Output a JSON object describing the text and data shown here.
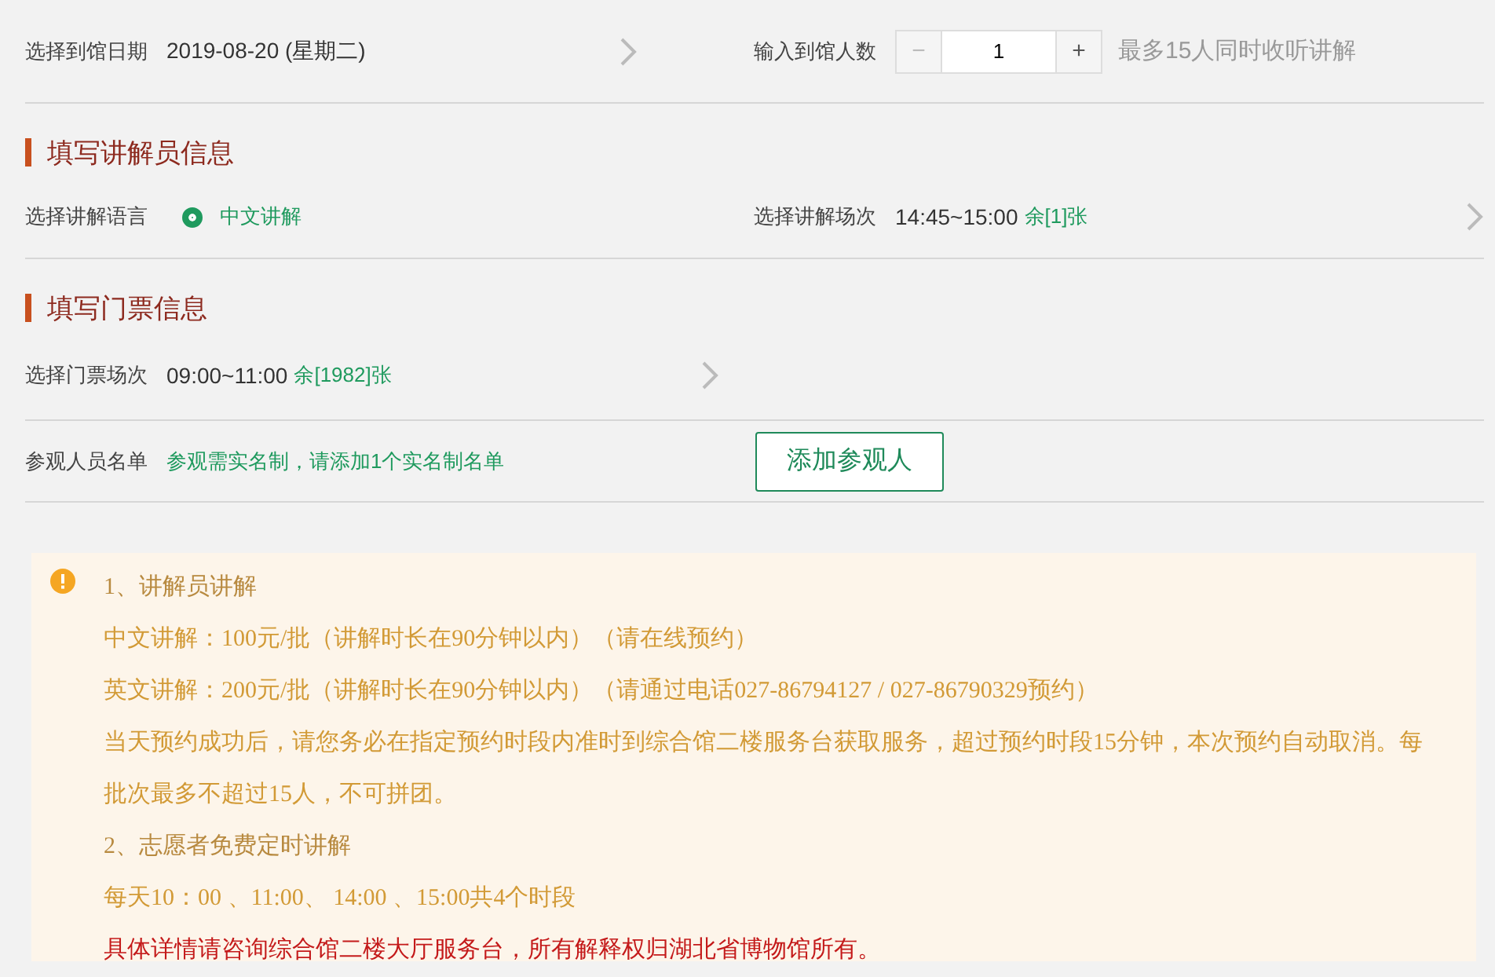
{
  "date_row": {
    "label": "选择到馆日期",
    "value": "2019-08-20 (星期二)"
  },
  "visitors": {
    "label": "输入到馆人数",
    "minus": "−",
    "minus_disabled": true,
    "value": "1",
    "plus": "+",
    "hint": "最多15人同时收听讲解"
  },
  "guide_section": {
    "title": "填写讲解员信息",
    "language": {
      "label": "选择讲解语言",
      "options": [
        {
          "label": "中文讲解",
          "selected": true
        }
      ]
    },
    "session": {
      "label": "选择讲解场次",
      "time": "14:45~15:00",
      "remaining": "余[1]张"
    }
  },
  "ticket_section": {
    "title": "填写门票信息",
    "session": {
      "label": "选择门票场次",
      "time": "09:00~11:00",
      "remaining": "余[1982]张"
    },
    "visitor_list": {
      "label": "参观人员名单",
      "note": "参观需实名制，请添加1个实名制名单",
      "button": "添加参观人"
    }
  },
  "notice": {
    "lines": [
      {
        "kind": "heading",
        "text": "1、讲解员讲解"
      },
      {
        "kind": "normal",
        "text": "中文讲解：100元/批（讲解时长在90分钟以内）（请在线预约）"
      },
      {
        "kind": "normal",
        "text": "英文讲解：200元/批（讲解时长在90分钟以内）（请通过电话027-86794127 / 027-86790329预约）"
      },
      {
        "kind": "normal",
        "text": "当天预约成功后，请您务必在指定预约时段内准时到综合馆二楼服务台获取服务，超过预约时段15分钟，本次预约自动取消。每批次最多不超过15人，不可拼团。"
      },
      {
        "kind": "heading",
        "text": "2、志愿者免费定时讲解"
      },
      {
        "kind": "normal",
        "text": "每天10：00 、11:00、 14:00 、15:00共4个时段"
      },
      {
        "kind": "warning",
        "text": "具体详情请咨询综合馆二楼大厅服务台，所有解释权归湖北省博物馆所有。"
      }
    ]
  }
}
